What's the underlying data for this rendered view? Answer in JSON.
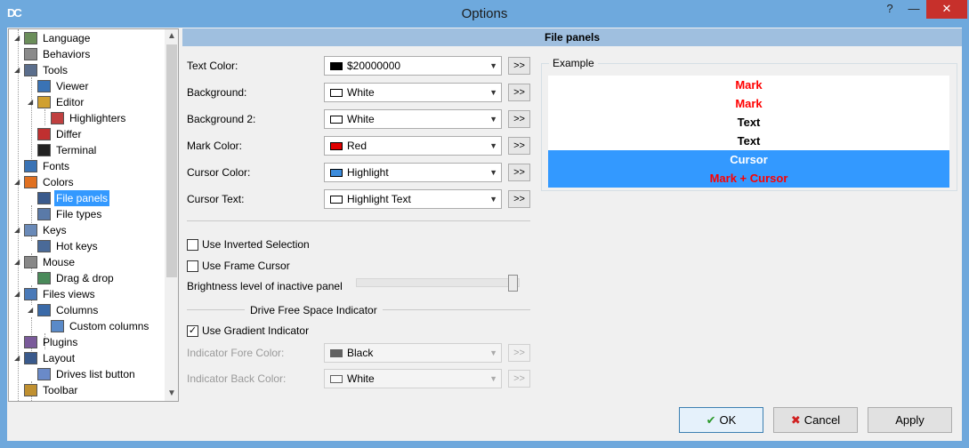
{
  "window": {
    "title": "Options",
    "app_icon": "DC",
    "help_glyph": "?",
    "min_glyph": "—",
    "close_glyph": "✕"
  },
  "colors": {
    "selection": "#3399ff",
    "header": "#9fbfdf",
    "titlebar": "#6ea9dd",
    "mark": "#ff0000",
    "cursor_bg": "#3399ff"
  },
  "tree": {
    "items": [
      {
        "label": "Language",
        "icon": "language-icon"
      },
      {
        "label": "Behaviors",
        "icon": "lock-icon"
      },
      {
        "label": "Tools",
        "icon": "tools-icon"
      },
      {
        "label": "Viewer",
        "icon": "book-icon"
      },
      {
        "label": "Editor",
        "icon": "edit-icon"
      },
      {
        "label": "Highlighters",
        "icon": "document-icon"
      },
      {
        "label": "Differ",
        "icon": "code-icon"
      },
      {
        "label": "Terminal",
        "icon": "terminal-icon"
      },
      {
        "label": "Fonts",
        "icon": "font-icon"
      },
      {
        "label": "Colors",
        "icon": "color-wheel-icon"
      },
      {
        "label": "File panels",
        "icon": "panels-icon"
      },
      {
        "label": "File types",
        "icon": "list-icon"
      },
      {
        "label": "Keys",
        "icon": "keyboard-icon"
      },
      {
        "label": "Hot keys",
        "icon": "hotkey-icon"
      },
      {
        "label": "Mouse",
        "icon": "mouse-icon"
      },
      {
        "label": "Drag & drop",
        "icon": "drag-icon"
      },
      {
        "label": "Files views",
        "icon": "files-view-icon"
      },
      {
        "label": "Columns",
        "icon": "columns-icon"
      },
      {
        "label": "Custom columns",
        "icon": "custom-columns-icon"
      },
      {
        "label": "Plugins",
        "icon": "plugins-icon"
      },
      {
        "label": "Layout",
        "icon": "layout-icon"
      },
      {
        "label": "Drives list button",
        "icon": "drives-icon"
      },
      {
        "label": "Toolbar",
        "icon": "toolbar-icon"
      }
    ]
  },
  "panel": {
    "header": "File panels",
    "rows": [
      {
        "label": "Text Color:",
        "value": "$20000000",
        "swatch": "#000000",
        "more": ">>"
      },
      {
        "label": "Background:",
        "value": "White",
        "swatch": "#ffffff",
        "more": ">>"
      },
      {
        "label": "Background 2:",
        "value": "White",
        "swatch": "#ffffff",
        "more": ">>"
      },
      {
        "label": "Mark Color:",
        "value": "Red",
        "swatch": "#e00000",
        "more": ">>"
      },
      {
        "label": "Cursor Color:",
        "value": "Highlight",
        "swatch": "#3c8cdc",
        "more": ">>"
      },
      {
        "label": "Cursor Text:",
        "value": "Highlight Text",
        "swatch": "#ffffff",
        "more": ">>"
      }
    ],
    "use_inverted_selection": {
      "label": "Use Inverted Selection",
      "checked": false
    },
    "use_frame_cursor": {
      "label": "Use Frame Cursor",
      "checked": false
    },
    "brightness": {
      "label": "Brightness level of inactive panel",
      "level_percent": 100
    },
    "drive_group_title": "Drive Free Space Indicator",
    "use_gradient": {
      "label": "Use Gradient Indicator",
      "checked": true,
      "mark": "✓"
    },
    "indicator_rows": [
      {
        "label": "Indicator Fore Color:",
        "value": "Black",
        "swatch": "#000000",
        "more": ">>"
      },
      {
        "label": "Indicator Back Color:",
        "value": "White",
        "swatch": "#ffffff",
        "more": ">>"
      }
    ]
  },
  "example": {
    "title": "Example",
    "rows": [
      {
        "text": "Mark",
        "color": "#ff0000",
        "bg": "#ffffff"
      },
      {
        "text": "Mark",
        "color": "#ff0000",
        "bg": "#ffffff"
      },
      {
        "text": "Text",
        "color": "#000000",
        "bg": "#ffffff"
      },
      {
        "text": "Text",
        "color": "#000000",
        "bg": "#ffffff"
      },
      {
        "text": "Cursor",
        "color": "#ffffff",
        "bg": "#3399ff"
      },
      {
        "text": "Mark + Cursor",
        "color": "#ff0000",
        "bg": "#3399ff"
      }
    ]
  },
  "buttons": {
    "ok": {
      "label": "OK",
      "glyph": "✔"
    },
    "cancel": {
      "label": "Cancel",
      "glyph": "✖"
    },
    "apply": {
      "label": "Apply"
    }
  },
  "scroll": {
    "up": "▲",
    "down": "▼"
  },
  "combo_arrow": "▼"
}
